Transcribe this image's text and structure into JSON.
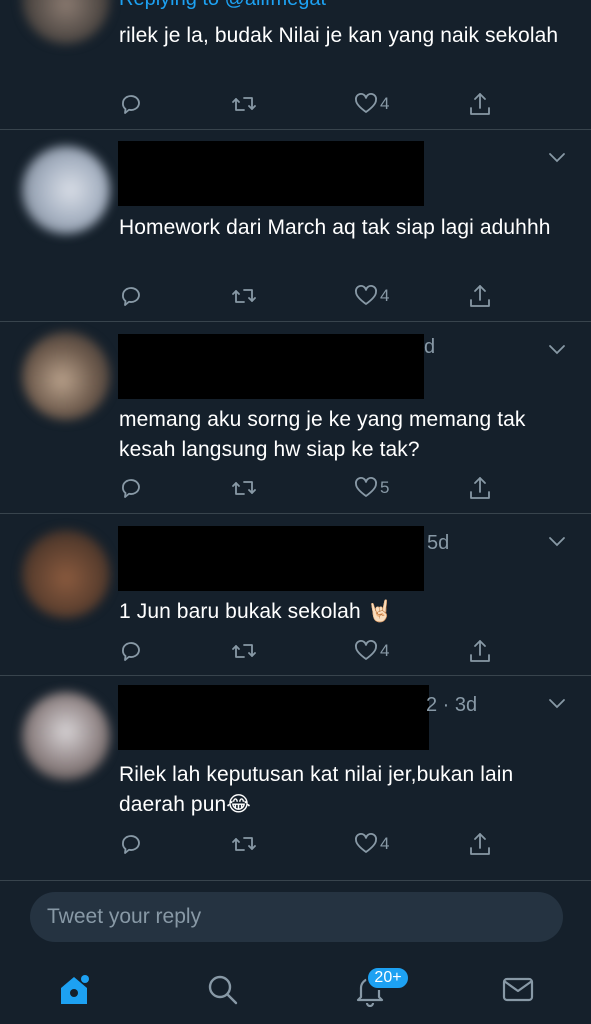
{
  "top_reply": {
    "replying_label": "Replying to @alifmegat",
    "text": "rilek je la, budak Nilai je kan yang naik sekolah",
    "likes": "4"
  },
  "tweets": [
    {
      "meta": "",
      "text": "Homework dari March aq tak siap lagi aduhhh",
      "likes": "4"
    },
    {
      "meta": "d",
      "text": "memang aku sorng je ke yang memang tak kesah langsung hw siap ke tak?",
      "likes": "5"
    },
    {
      "meta": "5d",
      "text": "1 Jun baru bukak sekolah 🤘🏻",
      "likes": "4"
    },
    {
      "meta": "2 · 3d",
      "text": "Rilek lah keputusan kat nilai jer,bukan lain daerah pun😂",
      "likes": "4"
    }
  ],
  "reply_box": {
    "placeholder": "Tweet your reply"
  },
  "tabbar": {
    "notifications_badge": "20+"
  },
  "colors": {
    "background": "#15202b",
    "secondary_text": "#8899a6",
    "accent": "#1da1f2",
    "divider": "#38444d"
  },
  "icons": [
    "reply-icon",
    "retweet-icon",
    "like-icon",
    "share-icon",
    "chevron-down-icon",
    "home-icon",
    "search-icon",
    "notifications-icon",
    "messages-icon"
  ]
}
